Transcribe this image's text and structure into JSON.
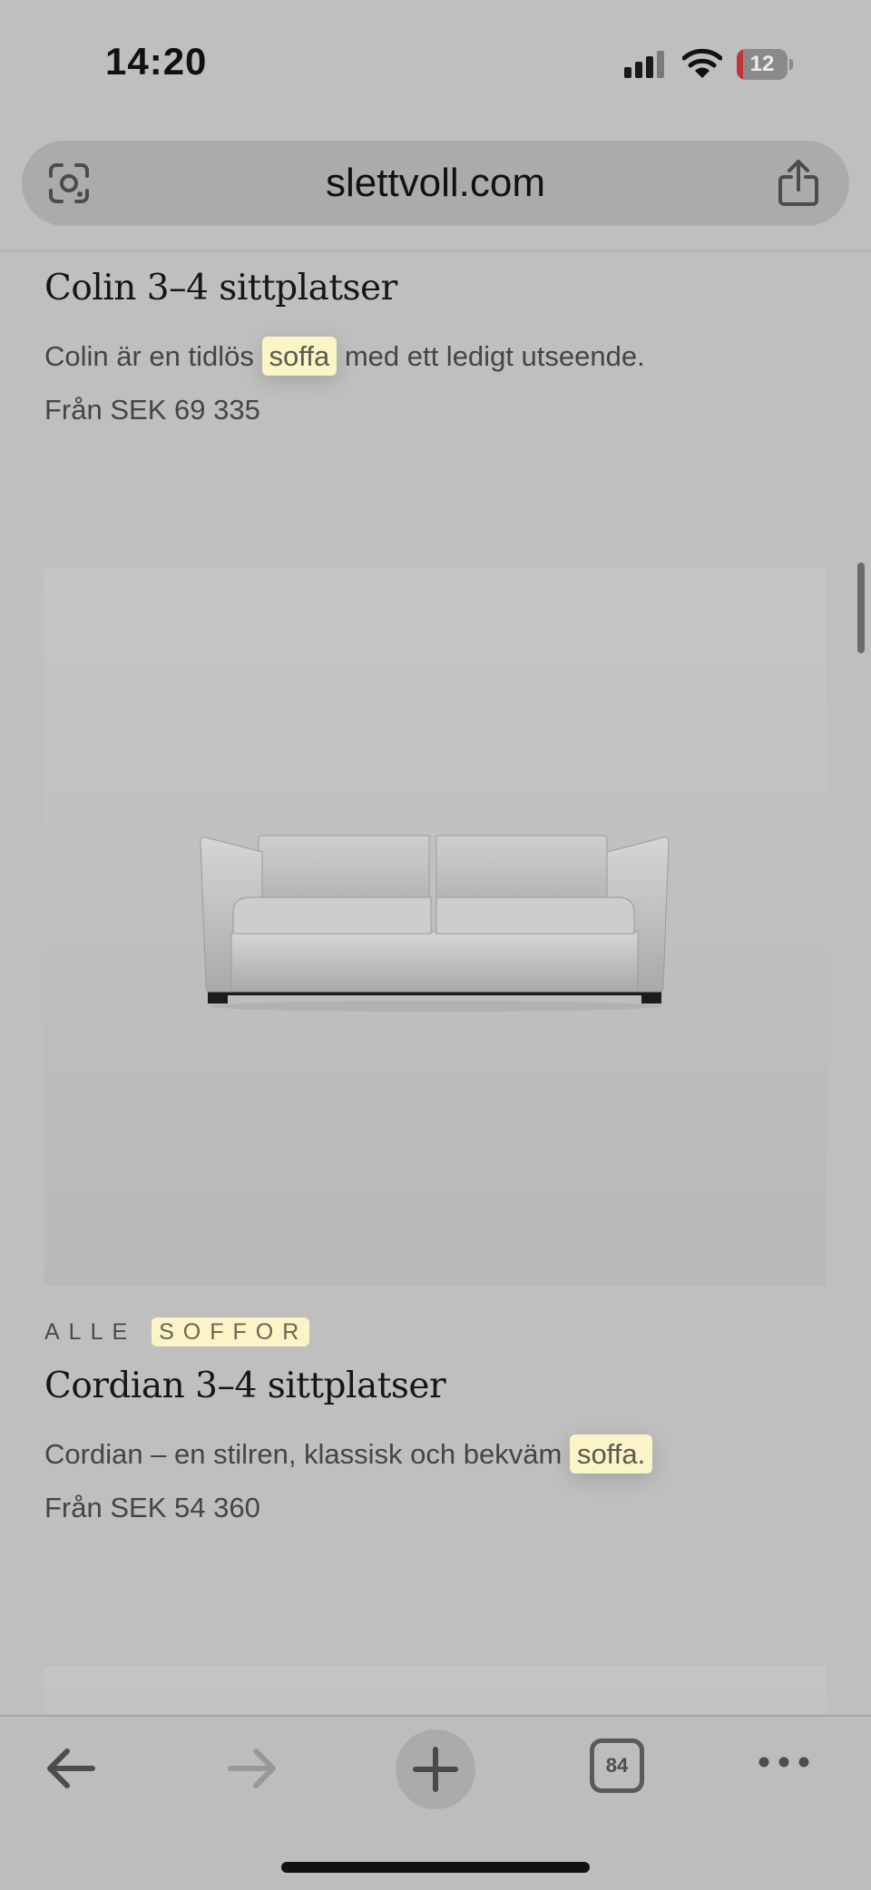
{
  "status_bar": {
    "time": "14:20",
    "battery_level": "12",
    "battery_fraction": 0.12,
    "icons": [
      "cellular-signal-icon",
      "wifi-icon",
      "battery-icon"
    ]
  },
  "url_bar": {
    "url": "slettvoll.com",
    "left_icon": "visual-search-icon",
    "right_icon": "share-icon"
  },
  "products": [
    {
      "title": "Colin 3–4 sittplatser",
      "desc_before": "Colin är en tidlös",
      "desc_highlight": "soffa",
      "desc_after": "med ett ledigt utseende.",
      "price": "Från SEK 69 335"
    },
    {
      "category_before": "ALLE",
      "category_highlight": "SOFFOR",
      "title": "Cordian 3–4 sittplatser",
      "desc_before": "Cordian – en stilren, klassisk och bekväm",
      "desc_highlight": "soffa.",
      "price": "Från SEK 54 360",
      "image": "sofa-image"
    }
  ],
  "toolbar": {
    "back_icon": "back-arrow-icon",
    "forward_icon": "forward-arrow-icon",
    "new_tab_icon": "plus-icon",
    "tab_count": "84",
    "more_icon": "more-dots-icon"
  },
  "colors": {
    "highlight": "#fbf4c6",
    "page_background": "#bfbfbf",
    "battery_low": "#c4333a"
  }
}
